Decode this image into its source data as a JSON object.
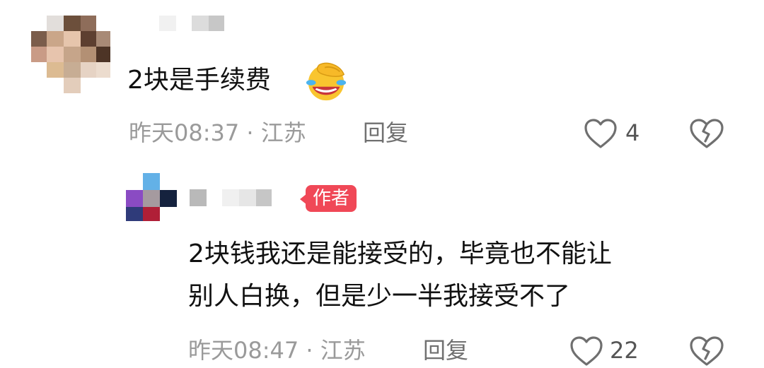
{
  "comments": [
    {
      "text": "2块是手续费",
      "emoji": "face-palm-crying-laughing-emoji",
      "meta": "昨天08:37 · 江苏",
      "reply_label": "回复",
      "likes": "4"
    },
    {
      "badge": "作者",
      "line1": "2块钱我还是能接受的，毕竟也不能让",
      "line2": "别人白换，但是少一半我接受不了",
      "meta": "昨天08:47 · 江苏",
      "reply_label": "回复",
      "likes": "22"
    }
  ],
  "icons": {
    "like": "heart-outline-icon",
    "dislike": "broken-heart-icon"
  },
  "colors": {
    "badge": "#f04857",
    "meta_text": "#9a9a9a",
    "primary_text": "#111111"
  }
}
